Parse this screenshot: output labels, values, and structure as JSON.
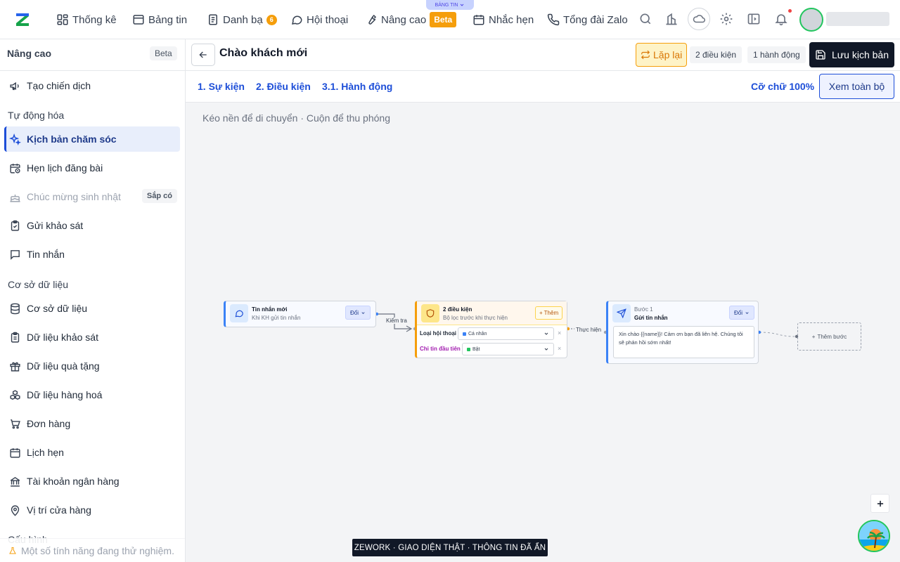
{
  "nav": {
    "items": [
      {
        "label": "Thống kê",
        "icon": "dashboard-icon"
      },
      {
        "label": "Bảng tin",
        "icon": "newsboard-icon"
      },
      {
        "label": "Danh bạ",
        "icon": "contacts-icon",
        "badge": "6"
      },
      {
        "label": "Hội thoại",
        "icon": "chat-icon"
      },
      {
        "label": "Nâng cao",
        "icon": "wrench-icon",
        "badge": "Beta"
      },
      {
        "label": "Nhắc hẹn",
        "icon": "calendar-icon"
      },
      {
        "label": "Tổng đài Zalo",
        "icon": "phone-icon"
      }
    ],
    "board_pill": "BẢNG TIN",
    "accent": "#f59e0b"
  },
  "sidebar": {
    "title": "Nâng cao",
    "title_badge": "Beta",
    "campaign": {
      "label": "Tạo chiến dịch",
      "icon": "megaphone-icon"
    },
    "section_automation": "Tự động hóa",
    "automation": [
      {
        "label": "Kịch bản chăm sóc",
        "icon": "sparkle-icon",
        "active": true
      },
      {
        "label": "Hẹn lịch đăng bài",
        "icon": "calendar-clock-icon"
      },
      {
        "label": "Chúc mừng sinh nhật",
        "icon": "cake-icon",
        "disabled": true,
        "tag": "Sắp có"
      },
      {
        "label": "Gửi khảo sát",
        "icon": "clipboard-check-icon"
      },
      {
        "label": "Tin nhắn",
        "icon": "message-icon"
      }
    ],
    "section_db": "Cơ sở dữ liệu",
    "database": [
      {
        "label": "Cơ sở dữ liệu",
        "icon": "database-icon"
      },
      {
        "label": "Dữ liệu khảo sát",
        "icon": "clipboard-icon"
      },
      {
        "label": "Dữ liệu quà tặng",
        "icon": "gift-icon"
      },
      {
        "label": "Dữ liệu hàng hoá",
        "icon": "boxes-icon"
      },
      {
        "label": "Đơn hàng",
        "icon": "cart-icon"
      },
      {
        "label": "Lịch hẹn",
        "icon": "calendar-icon"
      },
      {
        "label": "Tài khoản ngân hàng",
        "icon": "bank-icon"
      },
      {
        "label": "Vị trí cửa hàng",
        "icon": "location-icon"
      }
    ],
    "section_config": "Cấu hình",
    "footer": "Một số tính năng đang thử nghiệm."
  },
  "header": {
    "title": "Chào khách mới",
    "repeat": "Lặp lại",
    "conditions_chip": "2 điều kiện",
    "actions_chip": "1 hành động",
    "save": "Lưu kịch bản"
  },
  "steps": {
    "items": [
      "1. Sự kiện",
      "2. Điều kiện",
      "3.1. Hành động"
    ],
    "font_size": "Cỡ chữ 100%",
    "view_all": "Xem toàn bộ"
  },
  "canvas": {
    "hint": "Kéo nền để di chuyển · Cuộn để thu phóng",
    "trigger": {
      "title": "Tin nhắn mới",
      "subtitle": "Khi KH gửi tin nhắn",
      "change": "Đổi"
    },
    "edge1": "Kiểm tra",
    "conditions": {
      "title": "2 điều kiện",
      "subtitle": "Bộ lọc trước khi thực hiện",
      "add": "Thêm",
      "rows": [
        {
          "label": "Loại hội thoại",
          "value": "Cá nhân",
          "color": "#3b82f6",
          "label_color": "#1f2937"
        },
        {
          "label": "Chỉ tin đầu tiên",
          "value": "Bật",
          "color": "#22c55e",
          "label_color": "#a21caf"
        }
      ]
    },
    "edge2": "Thực hiện",
    "action": {
      "step": "Bước 1",
      "title": "Gửi tin nhắn",
      "change": "Đổi",
      "message": "Xin chào {{name}}! Cảm ơn bạn đã liên hệ. Chúng tôi sẽ phản hồi sớm nhất!"
    },
    "add_step": "Thêm bước",
    "banner": "ZEWORK · GIAO DIỆN THẬT · THÔNG TIN ĐÃ ẨN"
  }
}
